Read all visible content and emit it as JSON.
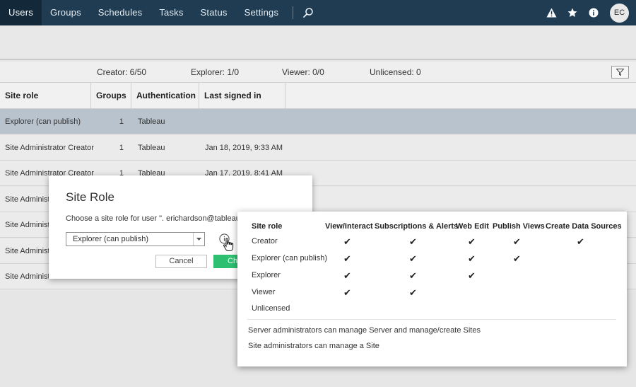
{
  "nav": {
    "tabs": [
      {
        "label": "Users",
        "active": true
      },
      {
        "label": "Groups"
      },
      {
        "label": "Schedules"
      },
      {
        "label": "Tasks"
      },
      {
        "label": "Status"
      },
      {
        "label": "Settings"
      }
    ],
    "icons": [
      "search-icon",
      "alert-icon",
      "star-icon",
      "info-icon"
    ],
    "avatar": "EC"
  },
  "counts": {
    "creator": "Creator: 6/50",
    "explorer": "Explorer: 1/0",
    "viewer": "Viewer: 0/0",
    "unlicensed": "Unlicensed: 0"
  },
  "table": {
    "headers": [
      "Site role",
      "Groups",
      "Authentication",
      "Last signed in"
    ],
    "rows": [
      {
        "role": "Explorer (can publish)",
        "groups": "1",
        "auth": "Tableau",
        "last": ""
      },
      {
        "role": "Site Administrator Creator",
        "groups": "1",
        "auth": "Tableau",
        "last": "Jan 18, 2019, 9:33 AM"
      },
      {
        "role": "Site Administrator Creator",
        "groups": "1",
        "auth": "Tableau",
        "last": "Jan 17, 2019, 8:41 AM"
      },
      {
        "role": "Site Administ",
        "groups": "",
        "auth": "",
        "last": ""
      },
      {
        "role": "Site Administ",
        "groups": "",
        "auth": "",
        "last": ""
      },
      {
        "role": "Site Administ",
        "groups": "",
        "auth": "",
        "last": ""
      },
      {
        "role": "Site Administ",
        "groups": "",
        "auth": "",
        "last": ""
      }
    ]
  },
  "dialog": {
    "title": "Site Role",
    "prompt": "Choose a site role for user \". erichardson@tableau.com\"",
    "selected": "Explorer (can publish)",
    "cancel": "Cancel",
    "change": "Change"
  },
  "popup": {
    "headers": [
      "Site role",
      "View/Interact",
      "Subscriptions & Alerts",
      "Web Edit",
      "Publish Views",
      "Create Data Sources"
    ],
    "check": "✔",
    "roles": [
      {
        "name": "Creator",
        "perms": [
          true,
          true,
          true,
          true,
          true
        ]
      },
      {
        "name": "Explorer (can publish)",
        "perms": [
          true,
          true,
          true,
          true,
          false
        ]
      },
      {
        "name": "Explorer",
        "perms": [
          true,
          true,
          true,
          false,
          false
        ]
      },
      {
        "name": "Viewer",
        "perms": [
          true,
          true,
          false,
          false,
          false
        ]
      },
      {
        "name": "Unlicensed",
        "perms": [
          false,
          false,
          false,
          false,
          false
        ]
      }
    ],
    "notes": [
      "Server administrators can manage Server and manage/create Sites",
      "Site administrators can manage a Site"
    ]
  }
}
